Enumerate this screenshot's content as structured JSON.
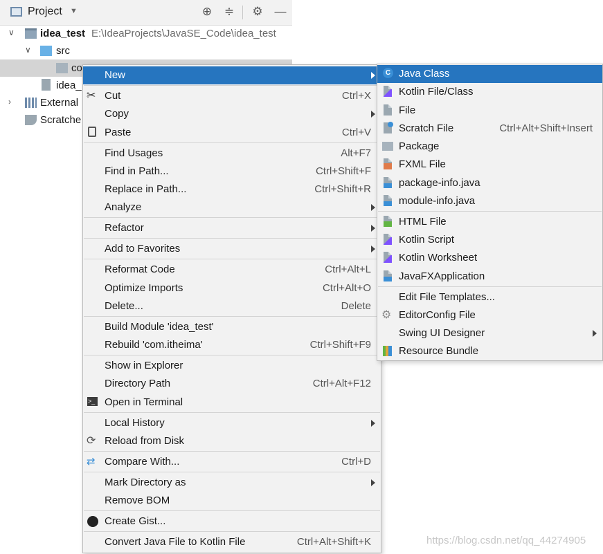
{
  "panel": {
    "title": "Project",
    "tree": {
      "project_name": "idea_test",
      "project_path": "E:\\IdeaProjects\\JavaSE_Code\\idea_test",
      "src": "src",
      "package": "com.itheima",
      "package_visible": "co",
      "iml": "idea_",
      "external": "External",
      "scratches": "Scratche"
    }
  },
  "main_menu": {
    "new": {
      "label": "New"
    },
    "cut": {
      "label": "Cut",
      "shortcut": "Ctrl+X"
    },
    "copy": {
      "label": "Copy"
    },
    "paste": {
      "label": "Paste",
      "shortcut": "Ctrl+V"
    },
    "find_usages": {
      "label": "Find Usages",
      "shortcut": "Alt+F7"
    },
    "find_in_path": {
      "label": "Find in Path...",
      "shortcut": "Ctrl+Shift+F"
    },
    "replace_in_path": {
      "label": "Replace in Path...",
      "shortcut": "Ctrl+Shift+R"
    },
    "analyze": {
      "label": "Analyze"
    },
    "refactor": {
      "label": "Refactor"
    },
    "add_to_favorites": {
      "label": "Add to Favorites"
    },
    "reformat_code": {
      "label": "Reformat Code",
      "shortcut": "Ctrl+Alt+L"
    },
    "optimize_imports": {
      "label": "Optimize Imports",
      "shortcut": "Ctrl+Alt+O"
    },
    "delete": {
      "label": "Delete...",
      "shortcut": "Delete"
    },
    "build_module": {
      "label": "Build Module 'idea_test'"
    },
    "rebuild": {
      "label": "Rebuild 'com.itheima'",
      "shortcut": "Ctrl+Shift+F9"
    },
    "show_in_explorer": {
      "label": "Show in Explorer"
    },
    "directory_path": {
      "label": "Directory Path",
      "shortcut": "Ctrl+Alt+F12"
    },
    "open_in_terminal": {
      "label": "Open in Terminal"
    },
    "local_history": {
      "label": "Local History"
    },
    "reload_from_disk": {
      "label": "Reload from Disk"
    },
    "compare_with": {
      "label": "Compare With...",
      "shortcut": "Ctrl+D"
    },
    "mark_directory_as": {
      "label": "Mark Directory as"
    },
    "remove_bom": {
      "label": "Remove BOM"
    },
    "create_gist": {
      "label": "Create Gist..."
    },
    "convert_java": {
      "label": "Convert Java File to Kotlin File",
      "shortcut": "Ctrl+Alt+Shift+K"
    }
  },
  "sub_menu": {
    "java_class": {
      "label": "Java Class"
    },
    "kotlin_file": {
      "label": "Kotlin File/Class"
    },
    "file": {
      "label": "File"
    },
    "scratch_file": {
      "label": "Scratch File",
      "shortcut": "Ctrl+Alt+Shift+Insert"
    },
    "package": {
      "label": "Package"
    },
    "fxml_file": {
      "label": "FXML File"
    },
    "package_info": {
      "label": "package-info.java"
    },
    "module_info": {
      "label": "module-info.java"
    },
    "html_file": {
      "label": "HTML File"
    },
    "kotlin_script": {
      "label": "Kotlin Script"
    },
    "kotlin_worksheet": {
      "label": "Kotlin Worksheet"
    },
    "javafx_app": {
      "label": "JavaFXApplication"
    },
    "edit_templates": {
      "label": "Edit File Templates..."
    },
    "editorconfig": {
      "label": "EditorConfig File"
    },
    "swing_designer": {
      "label": "Swing UI Designer"
    },
    "resource_bundle": {
      "label": "Resource Bundle"
    }
  },
  "watermark": "https://blog.csdn.net/qq_44274905",
  "colors": {
    "selection": "#2675bf",
    "menu_bg": "#f2f2f2",
    "kotlin": "#7f52ff",
    "java": "#3a8fd6"
  }
}
